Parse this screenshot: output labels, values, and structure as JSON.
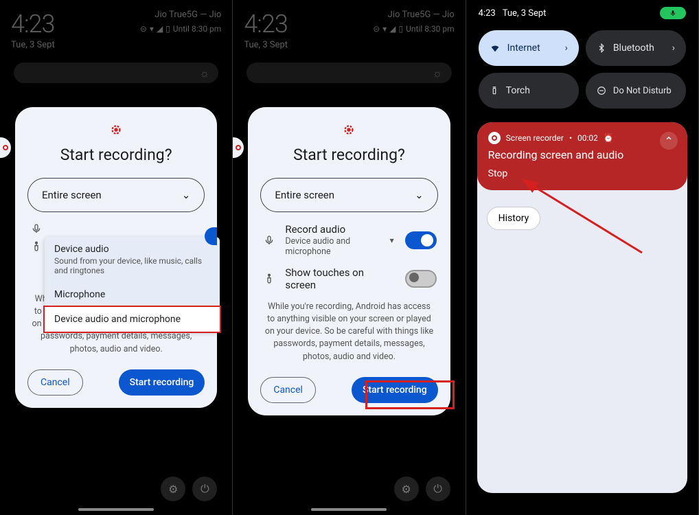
{
  "status": {
    "time": "4:23",
    "date": "Tue, 3 Sept",
    "carrier": "Jio True5G — Jio",
    "until": "Until 8:30 pm"
  },
  "dialog": {
    "title": "Start recording?",
    "select_value": "Entire screen",
    "record_audio_label": "Record audio",
    "record_audio_sub": "Device audio and microphone",
    "show_touches_label": "Show touches on screen",
    "disclaimer": "While you're recording, Android has access to anything visible on your screen or played on your device. So be careful with things like passwords, payment details, messages, photos, audio and video.",
    "cancel": "Cancel",
    "start": "Start recording"
  },
  "panel1": {
    "disclaimer_partial": "Wh\nanyth\ndevice. So be careful with things like passwords, payment details, messages, photos, audio and video.",
    "popup": {
      "opt1_title": "Device audio",
      "opt1_sub": "Sound from your device, like music, calls and ringtones",
      "opt2_title": "Microphone",
      "opt3_title": "Device audio and microphone"
    }
  },
  "panel3": {
    "time": "4:23",
    "date": "Tue, 3 Sept",
    "tiles": {
      "internet": "Internet",
      "bluetooth": "Bluetooth",
      "torch": "Torch",
      "dnd": "Do Not Disturb"
    },
    "notif": {
      "app": "Screen recorder",
      "elapsed": "00:02",
      "title": "Recording screen and audio",
      "stop": "Stop"
    },
    "history": "History"
  }
}
